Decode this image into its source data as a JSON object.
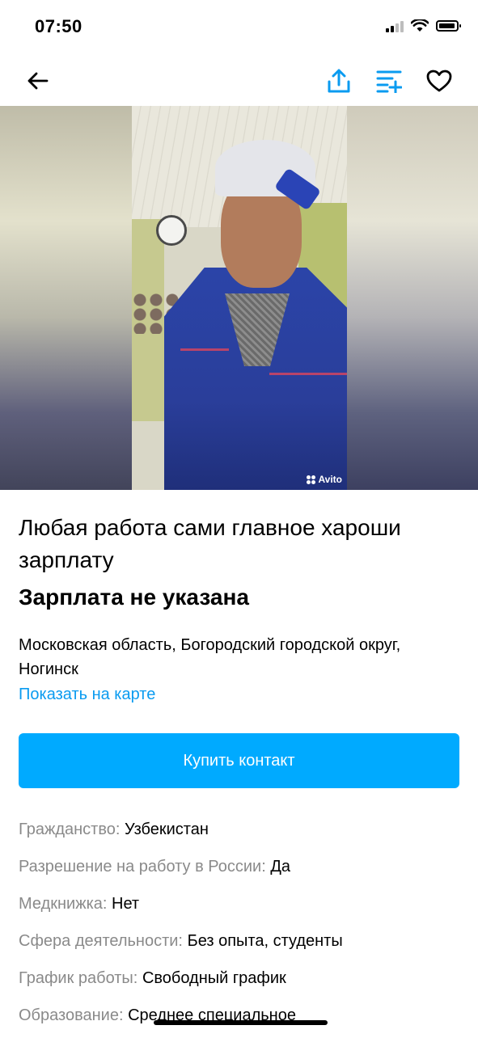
{
  "status_bar": {
    "time": "07:50"
  },
  "nav": {
    "back_icon": "arrow-left-icon",
    "share_icon": "share-icon",
    "compare_icon": "compare-list-icon",
    "favorite_icon": "heart-icon",
    "accent_color": "#0a9bf0"
  },
  "photo": {
    "watermark": "Avito"
  },
  "listing": {
    "title": "Любая работа сами главное хароши зарплату",
    "salary": "Зарплата не указана",
    "address": "Московская область, Богородский городской округ, Ногинск",
    "map_link": "Показать на карте",
    "buy_button": "Купить контакт",
    "button_color": "#00aaff"
  },
  "params": [
    {
      "key": "Гражданство:",
      "value": "Узбекистан"
    },
    {
      "key": "Разрешение на работу в России:",
      "value": "Да"
    },
    {
      "key": "Медкнижка:",
      "value": "Нет"
    },
    {
      "key": "Сфера деятельности:",
      "value": "Без опыта, студенты"
    },
    {
      "key": "График работы:",
      "value": "Свободный график"
    },
    {
      "key": "Образование:",
      "value": "Среднее специальное"
    }
  ]
}
